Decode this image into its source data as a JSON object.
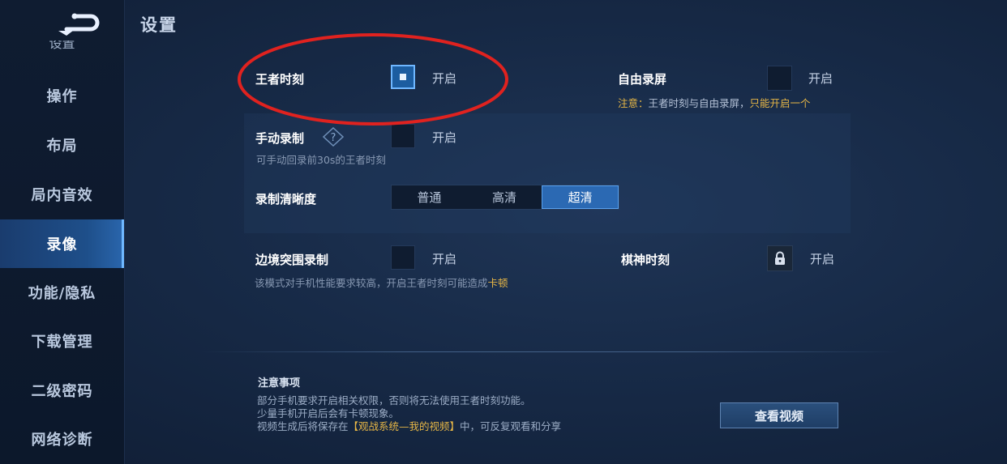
{
  "page": {
    "title": "设置"
  },
  "sidebar": {
    "partial_label": "设置",
    "items": [
      {
        "label": "操作"
      },
      {
        "label": "布局"
      },
      {
        "label": "局内音效"
      },
      {
        "label": "录像"
      },
      {
        "label": "功能/隐私"
      },
      {
        "label": "下载管理"
      },
      {
        "label": "二级密码"
      },
      {
        "label": "网络诊断"
      }
    ],
    "active_item": "录像"
  },
  "settings": {
    "wangzhe_moment": {
      "label": "王者时刻",
      "toggle_label": "开启",
      "checked": true
    },
    "free_record": {
      "label": "自由录屏",
      "toggle_label": "开启",
      "checked": false,
      "note_prefix": "注意：",
      "note_middle": "王者时刻与自由录屏，",
      "note_highlight": "只能开启一个"
    },
    "manual_record": {
      "label": "手动录制",
      "toggle_label": "开启",
      "checked": false,
      "description": "可手动回录前30s的王者时刻"
    },
    "quality": {
      "label": "录制清晰度",
      "options": [
        "普通",
        "高清",
        "超清"
      ],
      "selected": "超清"
    },
    "border_breakout": {
      "label": "边境突围录制",
      "toggle_label": "开启",
      "checked": false,
      "description_prefix": "该模式对手机性能要求较高，开启王者时刻可能造成",
      "description_highlight": "卡顿"
    },
    "chess_moment": {
      "label": "棋神时刻",
      "toggle_label": "开启",
      "locked": true
    }
  },
  "notes": {
    "title": "注意事项",
    "line1": "部分手机要求开启相关权限，否则将无法使用王者时刻功能。",
    "line2": "少量手机开启后会有卡顿现象。",
    "line3_prefix": "视频生成后将保存在",
    "line3_highlight": "【观战系统—我的视频】",
    "line3_suffix": "中，可反复观看和分享"
  },
  "view_video_button": {
    "label": "查看视频"
  },
  "colors": {
    "accent": "#2b69b3",
    "highlight": "#e6b646",
    "annotation": "#e0221f"
  }
}
